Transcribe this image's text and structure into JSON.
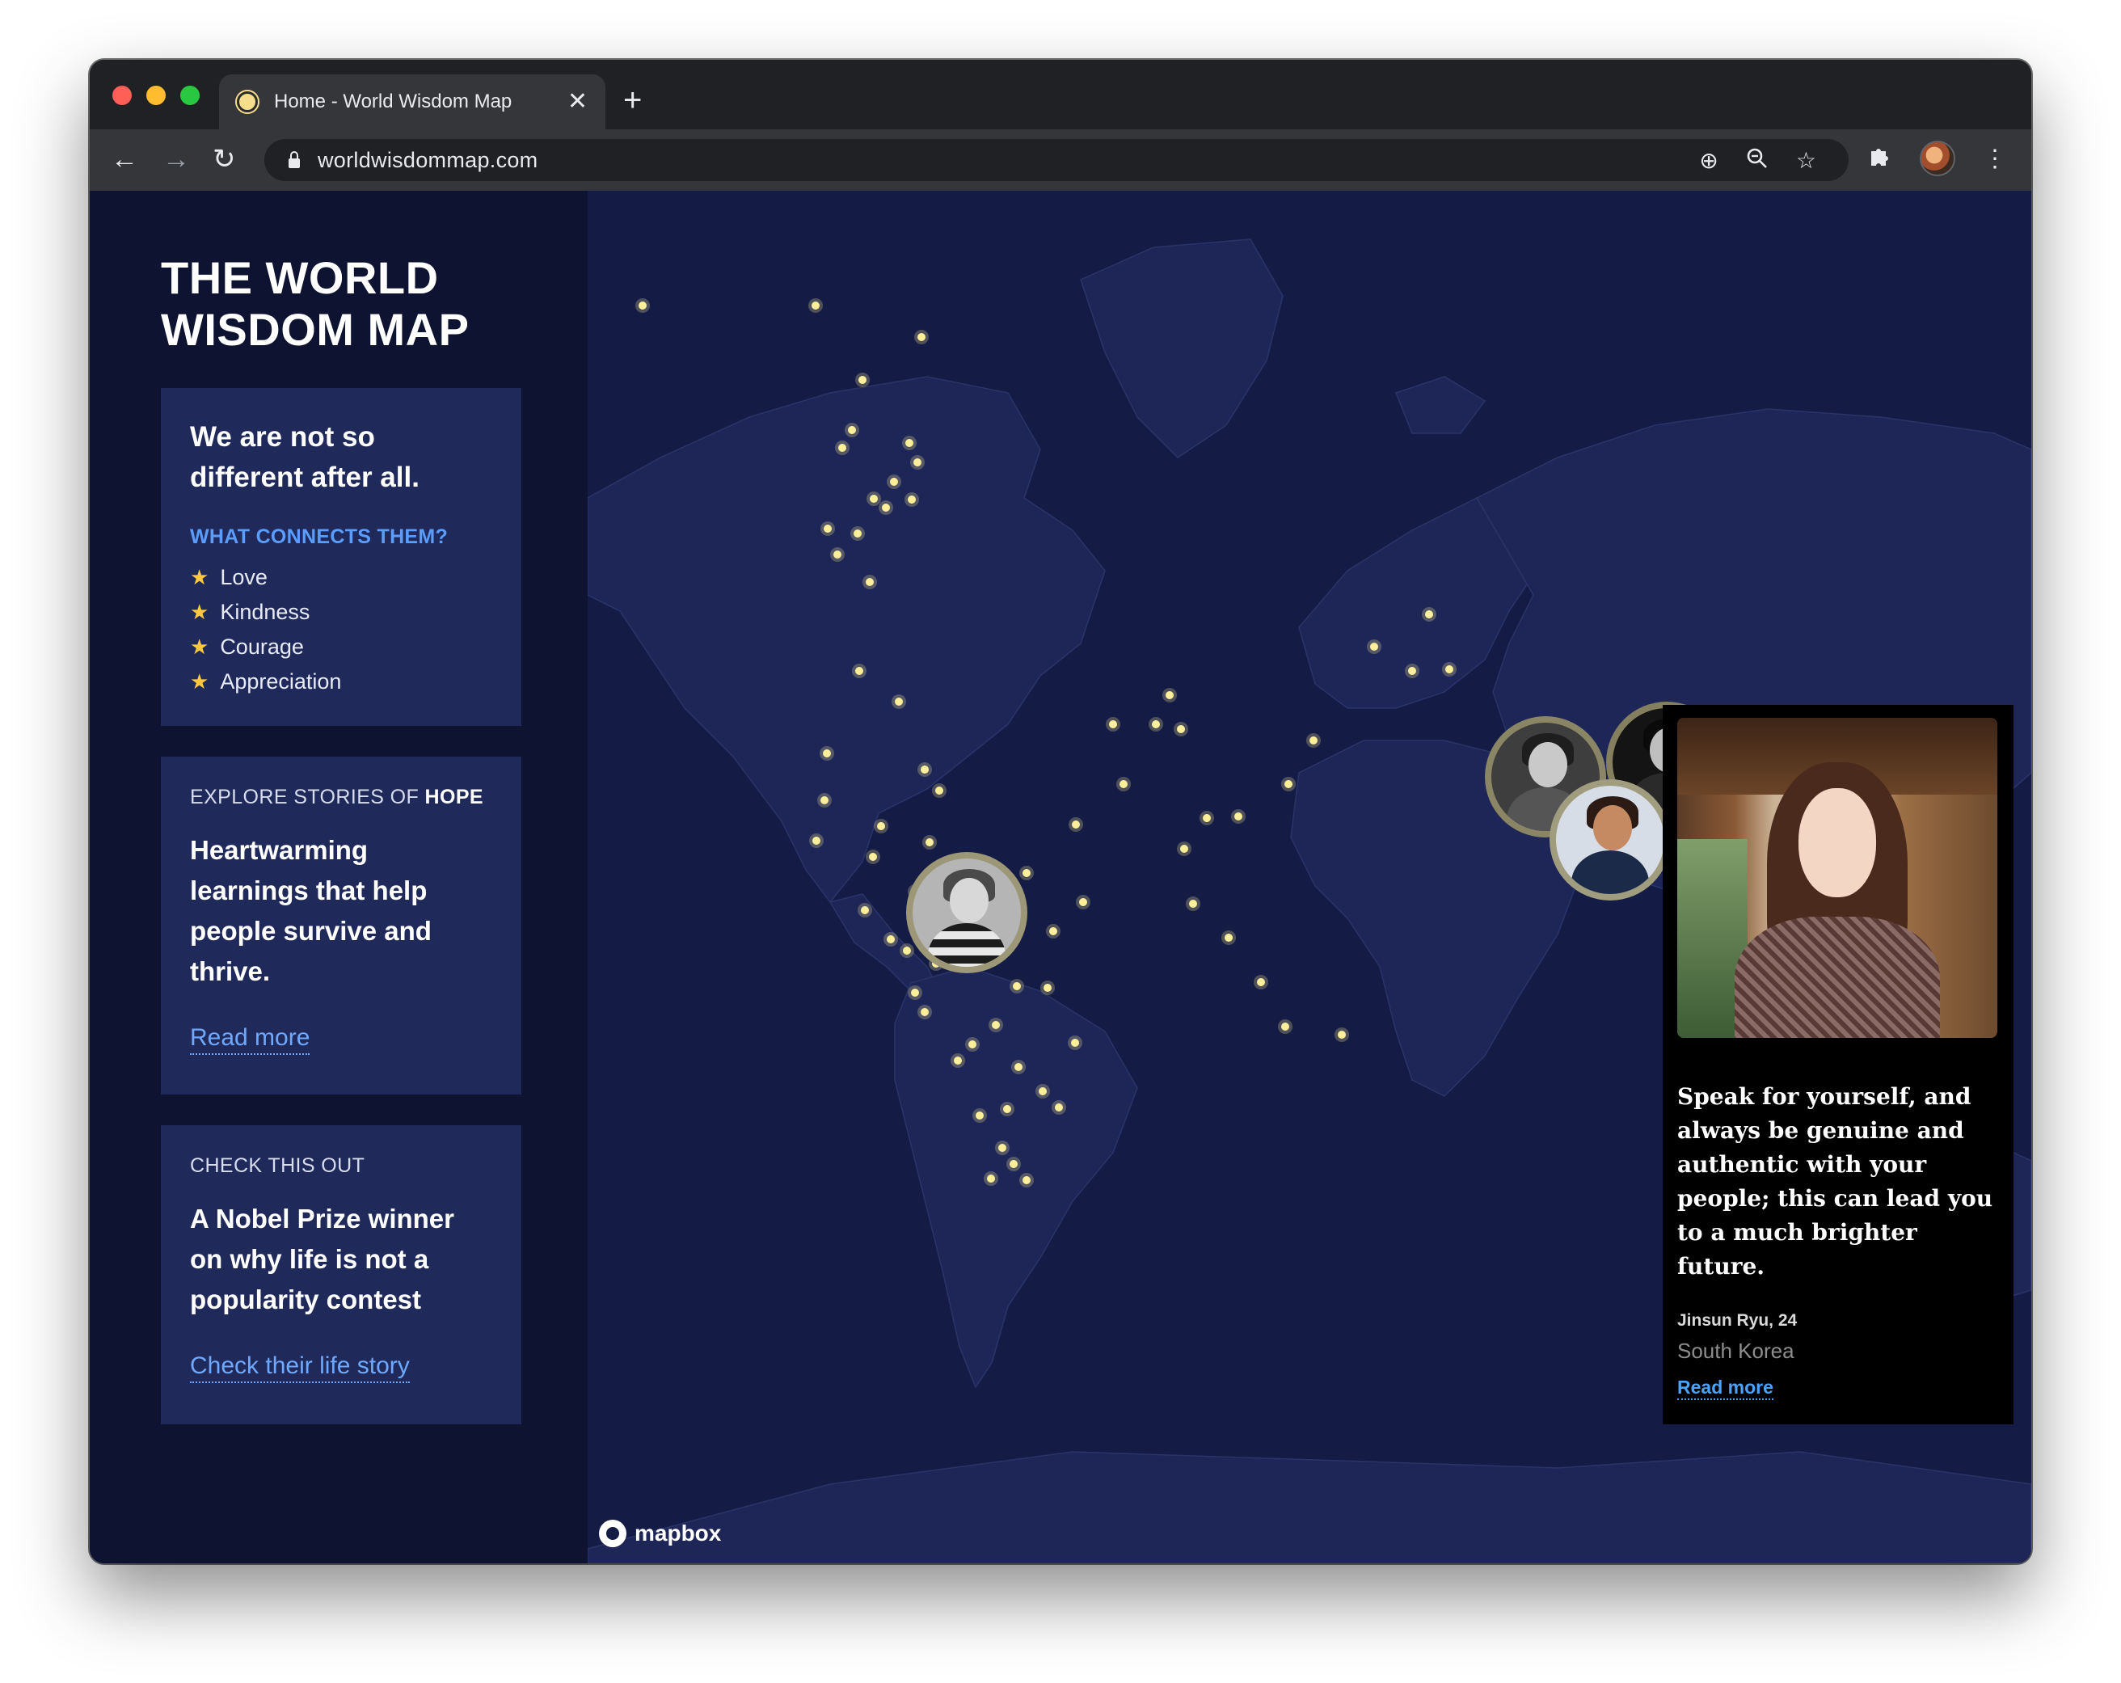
{
  "browser": {
    "tab_title": "Home - World Wisdom Map",
    "tab_close": "✕",
    "new_tab": "+",
    "url": "worldwisdommap.com"
  },
  "site": {
    "title_line1": "THE WORLD",
    "title_line2": "WISDOM MAP"
  },
  "card_connect": {
    "heading": "We are not so different after all.",
    "kicker": "WHAT CONNECTS THEM?",
    "values": [
      "Love",
      "Kindness",
      "Courage",
      "Appreciation"
    ],
    "star": "★"
  },
  "card_hope": {
    "label_prefix": "EXPLORE STORIES OF ",
    "label_strong": "HOPE",
    "heading": "Heartwarming learnings that help people survive and thrive.",
    "link": "Read more"
  },
  "card_check": {
    "label": "CHECK THIS OUT",
    "heading": "A Nobel Prize winner on why life is not a popularity contest",
    "link": "Check their life story"
  },
  "map": {
    "attribution": "mapbox"
  },
  "story": {
    "quote": "Speak for yourself, and always be genuine and authentic with your people; this can lead you to a much brighter future.",
    "name": "Jinsun Ryu, 24",
    "country": "South Korea",
    "link": "Read more"
  },
  "colors": {
    "page_bg": "#0d1330",
    "card_bg": "#1f2a5a",
    "map_bg": "#141c45",
    "land": "#1e2858",
    "accent_link": "#6fa8ff",
    "marker": "#ffef9a"
  }
}
